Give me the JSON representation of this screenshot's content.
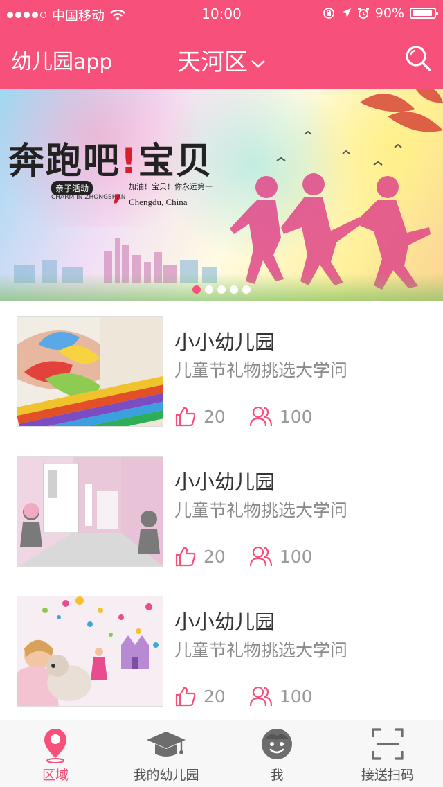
{
  "status_bar": {
    "carrier": "中国移动",
    "time": "10:00",
    "battery": "90%"
  },
  "nav": {
    "title": "幼儿园app",
    "region": "天河区"
  },
  "banner": {
    "headline_part1": "奔跑吧",
    "headline_mark": "!",
    "headline_part2": "宝贝",
    "tag": "亲子活动",
    "tag_sub": "CHARM IN ZHONGSHAN",
    "slogan": "加油！宝贝！你永远第一",
    "location": "Chengdu, China",
    "page_count": 5,
    "active_page": 1
  },
  "items": [
    {
      "title": "小小幼儿园",
      "desc": "儿童节礼物挑选大学问",
      "likes": "20",
      "members": "100"
    },
    {
      "title": "小小幼儿园",
      "desc": "儿童节礼物挑选大学问",
      "likes": "20",
      "members": "100"
    },
    {
      "title": "小小幼儿园",
      "desc": "儿童节礼物挑选大学问",
      "likes": "20",
      "members": "100"
    }
  ],
  "tabs": [
    {
      "label": "区域",
      "icon": "location-pin-icon",
      "active": true
    },
    {
      "label": "我的幼儿园",
      "icon": "graduation-cap-icon",
      "active": false
    },
    {
      "label": "我",
      "icon": "face-icon",
      "active": false
    },
    {
      "label": "接送扫码",
      "icon": "scan-icon",
      "active": false
    }
  ],
  "colors": {
    "accent": "#f7507a",
    "text_secondary": "#8a8a8a",
    "tab_inactive": "#555555"
  }
}
